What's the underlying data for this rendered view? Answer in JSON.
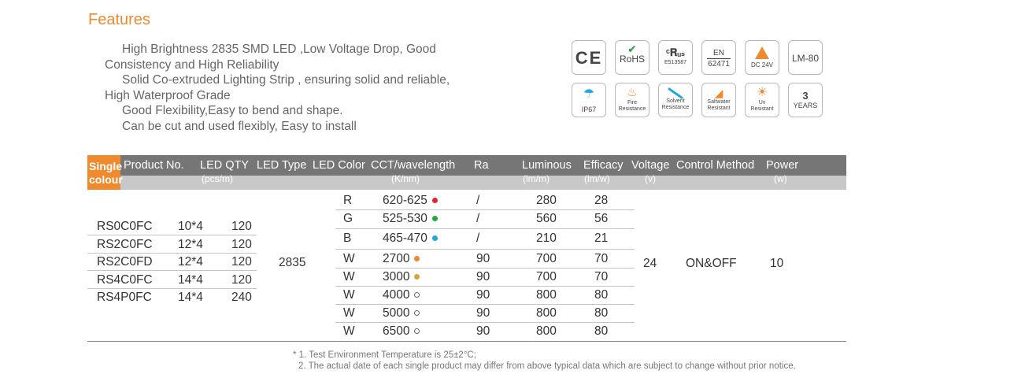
{
  "features": {
    "title": "Features",
    "items": [
      "High Brightness 2835 SMD LED ,Low Voltage Drop, Good Consistency and High Reliability",
      "Solid  Co-extruded Lighting Strip , ensuring solid and reliable, High Waterproof Grade",
      "Good Flexibility,Easy to bend and shape.",
      "Can be cut and used flexibly, Easy to install"
    ]
  },
  "certifications": {
    "ce": "CE",
    "rohs": "RoHS",
    "ul_number": "E513587",
    "en_label": "EN",
    "en_number": "62471",
    "dc": "DC 24V",
    "lm80": "LM-80",
    "ip67": "IP67",
    "fire_1": "Fire",
    "fire_2": "Resistance",
    "solvent_1": "Solvent",
    "solvent_2": "Resistance",
    "salt_1": "Saltwater",
    "salt_2": "Resistant",
    "uv_1": "Uv",
    "uv_2": "Resistant",
    "years_num": "3",
    "years_label": "YEARS"
  },
  "table": {
    "single_1": "Single",
    "single_2": "colour",
    "headers": {
      "product_no": "Product No.",
      "led_qty": "LED QTY",
      "led_qty_unit": "(pcs/m)",
      "led_type": "LED Type",
      "led_color": "LED Color",
      "cct": "CCT/wavelength",
      "cct_unit": "(K/nm)",
      "ra": "Ra",
      "luminous": "Luminous",
      "luminous_unit": "(lm/m)",
      "efficacy": "Efficacy",
      "efficacy_unit": "(lm/w)",
      "voltage": "Voltage",
      "voltage_unit": "(v)",
      "control": "Control Method",
      "power": "Power",
      "power_unit": "(w)"
    },
    "products": [
      {
        "no": "RS0C0FC",
        "config": "10*4",
        "qty": "120"
      },
      {
        "no": "RS2C0FC",
        "config": "12*4",
        "qty": "120"
      },
      {
        "no": "RS2C0FD",
        "config": "12*4",
        "qty": "120"
      },
      {
        "no": "RS4C0FC",
        "config": "14*4",
        "qty": "120"
      },
      {
        "no": "RS4P0FC",
        "config": "14*4",
        "qty": "240"
      }
    ],
    "led_type": "2835",
    "colors": [
      {
        "color": "R",
        "cct": "620-625",
        "dot": "#e4242a",
        "ra": "/",
        "lum": "280",
        "eff": "28"
      },
      {
        "color": "G",
        "cct": "525-530",
        "dot": "#23a844",
        "ra": "/",
        "lum": "560",
        "eff": "56"
      },
      {
        "color": "B",
        "cct": "465-470",
        "dot": "#1fa7e0",
        "ra": "/",
        "lum": "210",
        "eff": "21"
      },
      {
        "color": "W",
        "cct": "2700",
        "dot": "#ef8a2e",
        "ra": "90",
        "lum": "700",
        "eff": "70"
      },
      {
        "color": "W",
        "cct": "3000",
        "dot": "#d9a43a",
        "ra": "90",
        "lum": "700",
        "eff": "70"
      },
      {
        "color": "W",
        "cct": "4000",
        "dot": "open",
        "ra": "90",
        "lum": "800",
        "eff": "80"
      },
      {
        "color": "W",
        "cct": "5000",
        "dot": "open",
        "ra": "90",
        "lum": "800",
        "eff": "80"
      },
      {
        "color": "W",
        "cct": "6500",
        "dot": "open",
        "ra": "90",
        "lum": "800",
        "eff": "80"
      }
    ],
    "voltage": "24",
    "control": "ON&OFF",
    "power": "10"
  },
  "footnotes": {
    "note1": "* 1. Test Environment Temperature is 25±2°C;",
    "note2": "2. The actual date of each single product may differ from  above  typical data which are subject to change without prior notice."
  },
  "colors": {
    "accent": "#ef8a2e",
    "header_dark": "#767676",
    "header_light": "#c8c8c8"
  }
}
